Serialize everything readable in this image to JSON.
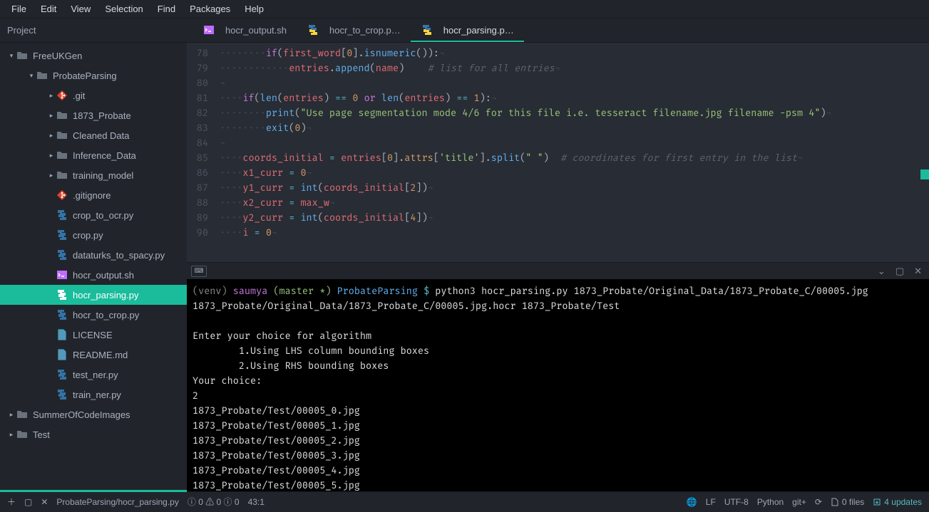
{
  "menu": [
    "File",
    "Edit",
    "View",
    "Selection",
    "Find",
    "Packages",
    "Help"
  ],
  "sidebar": {
    "title": "Project",
    "tree": [
      {
        "d": 0,
        "t": "folder",
        "exp": true,
        "chev": "▾",
        "label": "FreeUKGen"
      },
      {
        "d": 1,
        "t": "folder",
        "exp": true,
        "chev": "▾",
        "label": "ProbateParsing"
      },
      {
        "d": 2,
        "t": "git",
        "exp": false,
        "chev": "▸",
        "label": ".git"
      },
      {
        "d": 2,
        "t": "folder",
        "exp": false,
        "chev": "▸",
        "label": "1873_Probate"
      },
      {
        "d": 2,
        "t": "folder",
        "exp": false,
        "chev": "▸",
        "label": "Cleaned Data"
      },
      {
        "d": 2,
        "t": "folder",
        "exp": false,
        "chev": "▸",
        "label": "Inference_Data"
      },
      {
        "d": 2,
        "t": "folder",
        "exp": false,
        "chev": "▸",
        "label": "training_model"
      },
      {
        "d": 2,
        "t": "git",
        "chev": "",
        "label": ".gitignore"
      },
      {
        "d": 2,
        "t": "py",
        "chev": "",
        "label": "crop_to_ocr.py"
      },
      {
        "d": 2,
        "t": "py",
        "chev": "",
        "label": "crop.py"
      },
      {
        "d": 2,
        "t": "py",
        "chev": "",
        "label": "dataturks_to_spacy.py"
      },
      {
        "d": 2,
        "t": "sh",
        "chev": "",
        "label": "hocr_output.sh"
      },
      {
        "d": 2,
        "t": "py",
        "chev": "",
        "label": "hocr_parsing.py",
        "sel": true
      },
      {
        "d": 2,
        "t": "py",
        "chev": "",
        "label": "hocr_to_crop.py"
      },
      {
        "d": 2,
        "t": "txt",
        "chev": "",
        "label": "LICENSE"
      },
      {
        "d": 2,
        "t": "txt",
        "chev": "",
        "label": "README.md"
      },
      {
        "d": 2,
        "t": "py",
        "chev": "",
        "label": "test_ner.py"
      },
      {
        "d": 2,
        "t": "py",
        "chev": "",
        "label": "train_ner.py"
      },
      {
        "d": 0,
        "t": "folder",
        "exp": false,
        "chev": "▸",
        "label": "SummerOfCodeImages"
      },
      {
        "d": 0,
        "t": "folder",
        "exp": false,
        "chev": "▸",
        "label": "Test"
      }
    ]
  },
  "tabs": [
    {
      "icon": "sh",
      "label": "hocr_output.sh"
    },
    {
      "icon": "py",
      "label": "hocr_to_crop.p…"
    },
    {
      "icon": "py",
      "label": "hocr_parsing.p…",
      "active": true
    }
  ],
  "code_start_line": 78,
  "code_lines": [
    "<span class='inv'>········</span><span class='kw'>if</span>(<span class='var'>first_word</span>[<span class='num'>0</span>].<span class='fn'>isnumeric</span>()):<span class='inv'>¬</span>",
    "<span class='inv'>············</span><span class='var'>entries</span>.<span class='fn'>append</span>(<span class='var'>name</span>)    <span class='cmt'># list for all entries</span><span class='inv'>¬</span>",
    "<span class='inv'>¬</span>",
    "<span class='inv'>····</span><span class='kw'>if</span>(<span class='fn'>len</span>(<span class='var'>entries</span>) <span class='op'>==</span> <span class='num'>0</span> <span class='kw'>or</span> <span class='fn'>len</span>(<span class='var'>entries</span>) <span class='op'>==</span> <span class='num'>1</span>):<span class='inv'>¬</span>",
    "<span class='inv'>········</span><span class='fn'>print</span>(<span class='str'>\"Use page segmentation mode 4/6 for this file i.e. tesseract filename.jpg filename -psm 4\"</span>)<span class='inv'>¬</span>",
    "<span class='inv'>········</span><span class='fn'>exit</span>(<span class='num'>0</span>)<span class='inv'>¬</span>",
    "<span class='inv'>¬</span>",
    "<span class='inv'>····</span><span class='var'>coords_initial</span> <span class='op'>=</span> <span class='var'>entries</span>[<span class='num'>0</span>].<span class='attr'>attrs</span>[<span class='str'>'title'</span>].<span class='fn'>split</span>(<span class='str'>\" \"</span>)  <span class='cmt'># coordinates for first entry in the list</span><span class='inv'>¬</span>",
    "<span class='inv'>····</span><span class='var'>x1_curr</span> <span class='op'>=</span> <span class='num'>0</span><span class='inv'>¬</span>",
    "<span class='inv'>····</span><span class='var'>y1_curr</span> <span class='op'>=</span> <span class='fn'>int</span>(<span class='var'>coords_initial</span>[<span class='num'>2</span>])<span class='inv'>¬</span>",
    "<span class='inv'>····</span><span class='var'>x2_curr</span> <span class='op'>=</span> <span class='var'>max_w</span><span class='inv'>¬</span>",
    "<span class='inv'>····</span><span class='var'>y2_curr</span> <span class='op'>=</span> <span class='fn'>int</span>(<span class='var'>coords_initial</span>[<span class='num'>4</span>])<span class='inv'>¬</span>",
    "<span class='inv'>····</span><span class='var'>i</span> <span class='op'>=</span> <span class='num'>0</span><span class='inv'>¬</span>"
  ],
  "terminal": {
    "prompt": {
      "venv": "(venv)",
      "user": "saumya",
      "branch": "(master *)",
      "dir": "ProbateParsing",
      "dollar": "$"
    },
    "cmd": "python3 hocr_parsing.py 1873_Probate/Original_Data/1873_Probate_C/00005.jpg 1873_Probate/Original_Data/1873_Probate_C/00005.jpg.hocr 1873_Probate/Test",
    "out": [
      "",
      "Enter your choice for algorithm",
      "        1.Using LHS column bounding boxes",
      "        2.Using RHS bounding boxes",
      "Your choice:",
      "2",
      "1873_Probate/Test/00005_0.jpg",
      "1873_Probate/Test/00005_1.jpg",
      "1873_Probate/Test/00005_2.jpg",
      "1873_Probate/Test/00005_3.jpg",
      "1873_Probate/Test/00005_4.jpg",
      "1873_Probate/Test/00005_5.jpg"
    ]
  },
  "status": {
    "path": "ProbateParsing/hocr_parsing.py",
    "diag": "ⓘ 0 ⚠ 0 ⓘ 0",
    "pos": "43:1",
    "lf": "LF",
    "enc": "UTF-8",
    "lang": "Python",
    "git": "git+",
    "fetch": "⟳",
    "files": "0 files",
    "updates": "4 updates"
  }
}
